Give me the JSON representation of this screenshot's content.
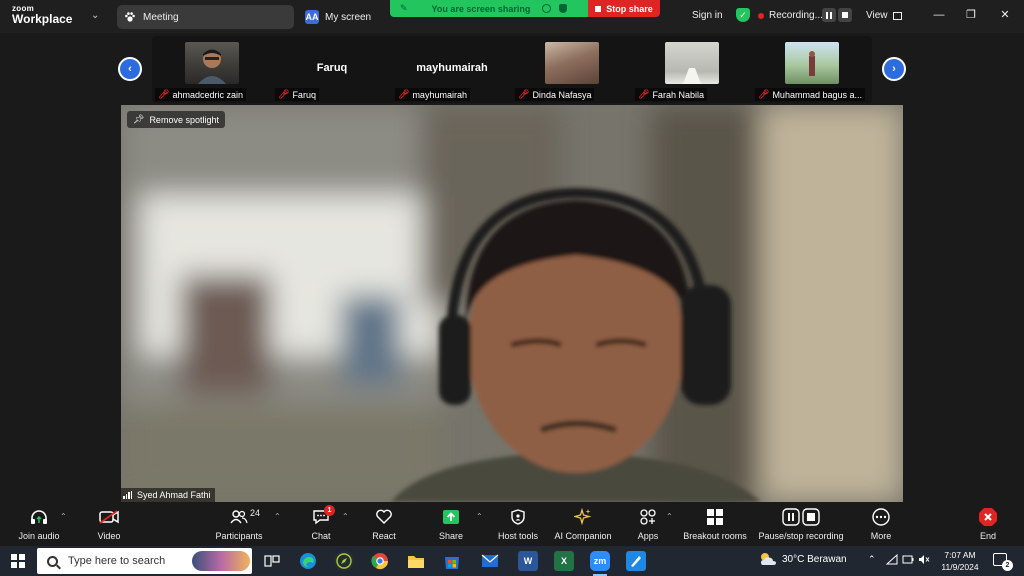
{
  "app": {
    "logo_top": "zoom",
    "logo_bottom": "Workplace"
  },
  "tabs": [
    {
      "label": "Meeting",
      "icon": "paw-icon"
    },
    {
      "label": "My screen",
      "icon": "aa-icon",
      "icon_text": "AA"
    }
  ],
  "sharing": {
    "status": "You are screen sharing",
    "stop_label": "Stop share",
    "color": "#22c55e",
    "stop_color": "#e02424"
  },
  "header": {
    "sign_in": "Sign in",
    "recording": "Recording...",
    "view": "View"
  },
  "participants_strip": [
    {
      "name": "ahmadcedric zain",
      "has_video": true
    },
    {
      "name": "Faruq",
      "big_name": "Faruq",
      "has_video": false
    },
    {
      "name": "mayhumairah",
      "big_name": "mayhumairah",
      "has_video": false
    },
    {
      "name": "Dinda Nafasya",
      "has_video": true
    },
    {
      "name": "Farah Nabila",
      "has_video": true
    },
    {
      "name": "Muhammad bagus a...",
      "has_video": true
    }
  ],
  "spotlight": {
    "button": "Remove spotlight",
    "speaker": "Syed Ahmad Fathi"
  },
  "toolbar": {
    "join_audio": "Join audio",
    "video": "Video",
    "participants": "Participants",
    "participants_count": "24",
    "chat": "Chat",
    "chat_badge": "1",
    "react": "React",
    "share": "Share",
    "host_tools": "Host tools",
    "ai_companion": "AI Companion",
    "apps": "Apps",
    "breakout_rooms": "Breakout rooms",
    "pause_stop_recording": "Pause/stop recording",
    "more": "More",
    "end": "End"
  },
  "taskbar": {
    "search_placeholder": "Type here to search",
    "weather": "30°C  Berawan",
    "time": "7:07 AM",
    "date": "11/9/2024",
    "notifications": "2"
  }
}
